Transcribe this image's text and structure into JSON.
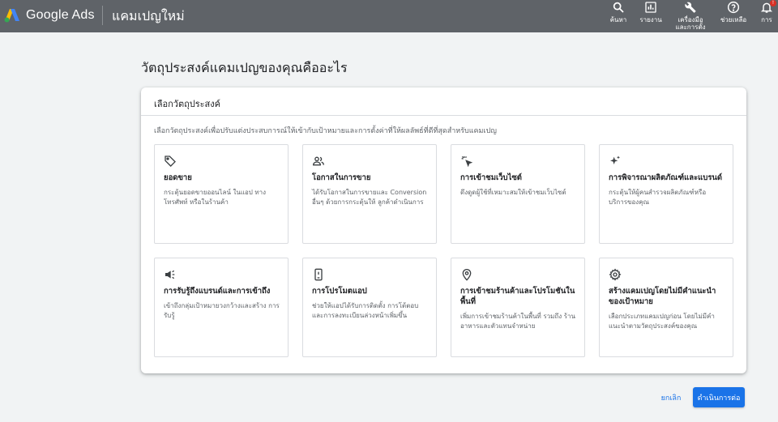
{
  "header": {
    "brand": "Google Ads",
    "campaign_title": "แคมเปญใหม่",
    "nav": [
      {
        "label": "ค้นหา",
        "icon": "search-icon"
      },
      {
        "label": "รายงาน",
        "icon": "reports-icon"
      },
      {
        "label": "เครื่องมือ\nและการตั้ง",
        "icon": "tools-icon"
      },
      {
        "label": "ช่วยเหลือ",
        "icon": "help-icon"
      },
      {
        "label": "การ",
        "icon": "bell-icon",
        "badge": "!"
      }
    ]
  },
  "page": {
    "title": "วัตถุประสงค์แคมเปญของคุณคืออะไร"
  },
  "card": {
    "header_title": "เลือกวัตถุประสงค์",
    "subtitle": "เลือกวัตถุประสงค์เพื่อปรับแต่งประสบการณ์ให้เข้ากับเป้าหมายและการตั้งค่าที่ให้ผลลัพธ์ที่ดีที่สุดสำหรับแคมเปญ",
    "goals": [
      {
        "name": "ยอดขาย",
        "desc": "กระตุ้นยอดขายออนไลน์ ในแอป ทาง โทรศัพท์ หรือในร้านค้า",
        "icon": "tag-icon"
      },
      {
        "name": "โอกาสในการขาย",
        "desc": "ได้รับโอกาสในการขายและ Conversion อื่นๆ ด้วยการกระตุ้นให้ ลูกค้าดำเนินการ",
        "icon": "people-icon"
      },
      {
        "name": "การเข้าชมเว็บไซต์",
        "desc": "ดึงดูดผู้ใช้ที่เหมาะสมให้เข้าชมเว็บไซต์",
        "icon": "click-icon"
      },
      {
        "name": "การพิจารณาผลิตภัณฑ์และแบรนด์",
        "desc": "กระตุ้นให้ผู้คนสำรวจผลิตภัณฑ์หรือ บริการของคุณ",
        "icon": "sparkle-icon"
      },
      {
        "name": "การรับรู้ถึงแบรนด์และการเข้าถึง",
        "desc": "เข้าถึงกลุ่มเป้าหมายวงกว้างและสร้าง การรับรู้",
        "icon": "megaphone-icon"
      },
      {
        "name": "การโปรโมตแอป",
        "desc": "ช่วยให้แอปได้รับการติดตั้ง การโต้ตอบ และการลงทะเบียนล่วงหน้าเพิ่มขึ้น",
        "icon": "phone-icon"
      },
      {
        "name": "การเข้าชมร้านค้าและโปรโมชันใน พื้นที่",
        "desc": "เพิ่มการเข้าชมร้านค้าในพื้นที่ รวมถึง ร้านอาหารและตัวแทนจำหน่าย",
        "icon": "location-pin-icon"
      },
      {
        "name": "สร้างแคมเปญโดยไม่มีคำแนะนำ ของเป้าหมาย",
        "desc": "เลือกประเภทแคมเปญก่อน โดยไม่มีคำ แนะนำตามวัตถุประสงค์ของคุณ",
        "icon": "gear-icon"
      }
    ]
  },
  "actions": {
    "cancel": "ยกเลิก",
    "continue": "ดำเนินการต่อ"
  },
  "colors": {
    "topbar": "#5f6368",
    "accent": "#1a73e8",
    "badge": "#d93025"
  }
}
